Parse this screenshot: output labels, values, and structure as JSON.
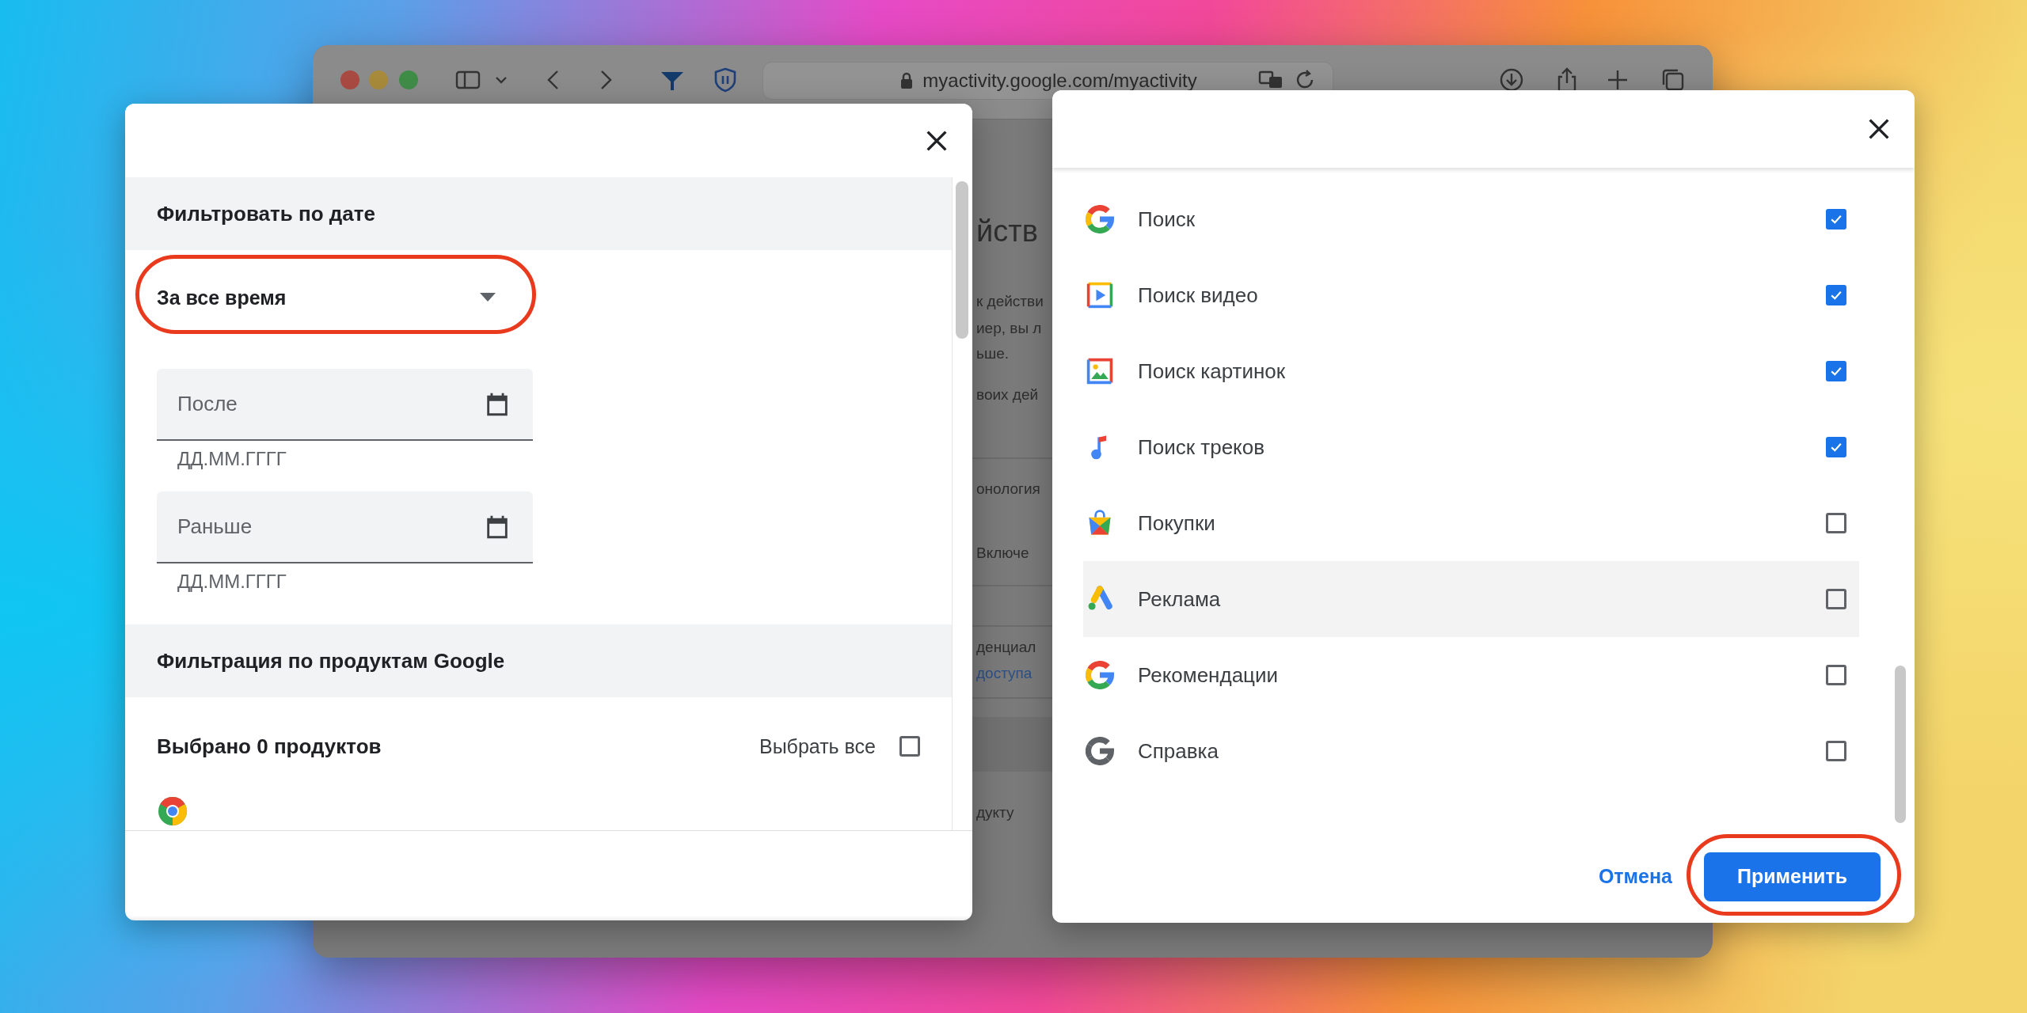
{
  "browser": {
    "url": "myactivity.google.com/myactivity"
  },
  "background_page": [
    {
      "kind": "title",
      "text": "йств"
    },
    {
      "kind": "text",
      "text": "к действи"
    },
    {
      "kind": "text",
      "text": "иер, вы л"
    },
    {
      "kind": "text",
      "text": "ьше."
    },
    {
      "kind": "text",
      "text": "воих дей"
    },
    {
      "kind": "text",
      "text": "онология"
    },
    {
      "kind": "text",
      "text": "Включе"
    },
    {
      "kind": "text",
      "text": "денциал"
    },
    {
      "kind": "link",
      "text": "доступа"
    },
    {
      "kind": "text",
      "text": "дукту"
    }
  ],
  "date_dialog": {
    "date_filter": {
      "heading": "Фильтровать по дате",
      "range": {
        "value": "За все время",
        "highlighted": true
      },
      "fields": [
        {
          "placeholder": "После",
          "hint": "ДД.ММ.ГГГГ"
        },
        {
          "placeholder": "Раньше",
          "hint": "ДД.ММ.ГГГГ"
        }
      ]
    },
    "product_filter": {
      "heading": "Фильтрация по продуктам Google",
      "count": "Выбрано 0 продуктов",
      "select_all": {
        "label": "Выбрать все",
        "checked": false
      }
    }
  },
  "products_dialog": {
    "products": [
      {
        "name": "Поиск",
        "checked": true,
        "hovered": false
      },
      {
        "name": "Поиск видео",
        "checked": true,
        "hovered": false
      },
      {
        "name": "Поиск картинок",
        "checked": true,
        "hovered": false
      },
      {
        "name": "Поиск треков",
        "checked": true,
        "hovered": false
      },
      {
        "name": "Покупки",
        "checked": false,
        "hovered": false
      },
      {
        "name": "Реклама",
        "checked": false,
        "hovered": true
      },
      {
        "name": "Рекомендации",
        "checked": false,
        "hovered": false
      },
      {
        "name": "Справка",
        "checked": false,
        "hovered": false
      }
    ],
    "cancel": "Отмена",
    "apply": {
      "label": "Применить",
      "highlighted": true
    }
  }
}
